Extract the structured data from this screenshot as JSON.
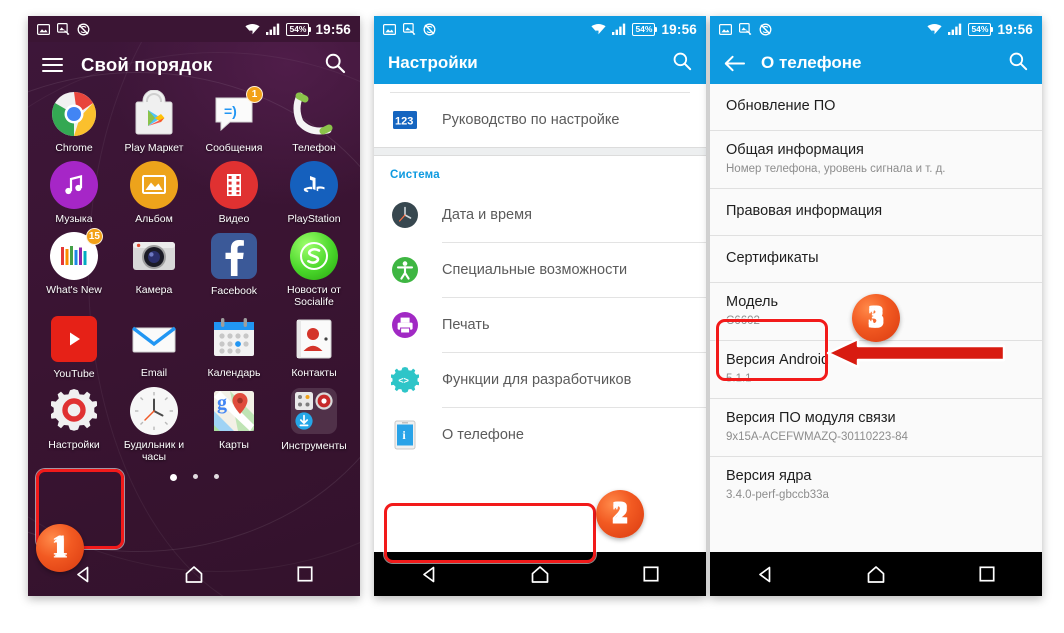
{
  "statusbar": {
    "battery": "54%",
    "time": "19:56",
    "icons": [
      "image-icon",
      "screenshot-icon",
      "no-sync-icon",
      "wifi-icon",
      "signal-icon",
      "battery-icon"
    ]
  },
  "panel1": {
    "title": "Свой порядок",
    "menu_icon": "hamburger-menu-icon",
    "search_icon": "search-icon",
    "apps": [
      {
        "label": "Chrome",
        "icon": "chrome-icon",
        "badge": null
      },
      {
        "label": "Play Маркет",
        "icon": "play-store-icon",
        "badge": null
      },
      {
        "label": "Сообщения",
        "icon": "messages-icon",
        "badge": "1"
      },
      {
        "label": "Телефон",
        "icon": "phone-icon",
        "badge": null
      },
      {
        "label": "Музыка",
        "icon": "music-icon",
        "badge": null
      },
      {
        "label": "Альбом",
        "icon": "album-icon",
        "badge": null
      },
      {
        "label": "Видео",
        "icon": "video-icon",
        "badge": null
      },
      {
        "label": "PlayStation",
        "icon": "playstation-icon",
        "badge": null
      },
      {
        "label": "What's New",
        "icon": "whats-new-icon",
        "badge": "15"
      },
      {
        "label": "Камера",
        "icon": "camera-icon",
        "badge": null
      },
      {
        "label": "Facebook",
        "icon": "facebook-icon",
        "badge": null
      },
      {
        "label": "Новости от Socialife",
        "icon": "socialife-icon",
        "badge": null
      },
      {
        "label": "YouTube",
        "icon": "youtube-icon",
        "badge": null
      },
      {
        "label": "Email",
        "icon": "email-icon",
        "badge": null
      },
      {
        "label": "Календарь",
        "icon": "calendar-icon",
        "badge": null
      },
      {
        "label": "Контакты",
        "icon": "contacts-icon",
        "badge": null
      },
      {
        "label": "Настройки",
        "icon": "settings-gear-icon",
        "badge": null
      },
      {
        "label": "Будильник и часы",
        "icon": "clock-icon",
        "badge": null
      },
      {
        "label": "Карты",
        "icon": "maps-icon",
        "badge": null
      },
      {
        "label": "Инструменты",
        "icon": "tools-folder-icon",
        "badge": null
      }
    ],
    "page_dots": 3,
    "active_dot": 1,
    "step": "1"
  },
  "panel2": {
    "title": "Настройки",
    "search_icon": "search-icon",
    "top_item": {
      "label": "Руководство по настройке",
      "icon": "setup-guide-123-icon"
    },
    "group_header": "Система",
    "items": [
      {
        "label": "Дата и время",
        "icon": "clock-icon"
      },
      {
        "label": "Специальные возможности",
        "icon": "accessibility-icon"
      },
      {
        "label": "Печать",
        "icon": "print-icon"
      },
      {
        "label": "Функции для разработчиков",
        "icon": "developer-options-icon"
      },
      {
        "label": "О телефоне",
        "icon": "about-phone-icon"
      }
    ],
    "step": "2"
  },
  "panel3": {
    "title": "О телефоне",
    "back_icon": "back-arrow-icon",
    "search_icon": "search-icon",
    "items": [
      {
        "title": "Обновление ПО",
        "subtitle": ""
      },
      {
        "title": "Общая информация",
        "subtitle": "Номер телефона, уровень сигнала и т. д."
      },
      {
        "title": "Правовая информация",
        "subtitle": ""
      },
      {
        "title": "Сертификаты",
        "subtitle": ""
      },
      {
        "title": "Модель",
        "subtitle": "C6602"
      },
      {
        "title": "Версия Android",
        "subtitle": "5.1.1"
      },
      {
        "title": "Версия ПО модуля связи",
        "subtitle": "9x15A-ACEFWMAZQ-30110223-84"
      },
      {
        "title": "Версия ядра",
        "subtitle": "3.4.0-perf-gbccb33a"
      }
    ],
    "step": "3"
  },
  "navbar": {
    "back": "back-triangle-icon",
    "home": "home-icon",
    "recents": "recents-square-icon"
  },
  "colors": {
    "accent_blue": "#0e9ae0",
    "home_purple": "#3b1534",
    "highlight_red": "#f21a1a",
    "step_orange": "#f25a22"
  }
}
